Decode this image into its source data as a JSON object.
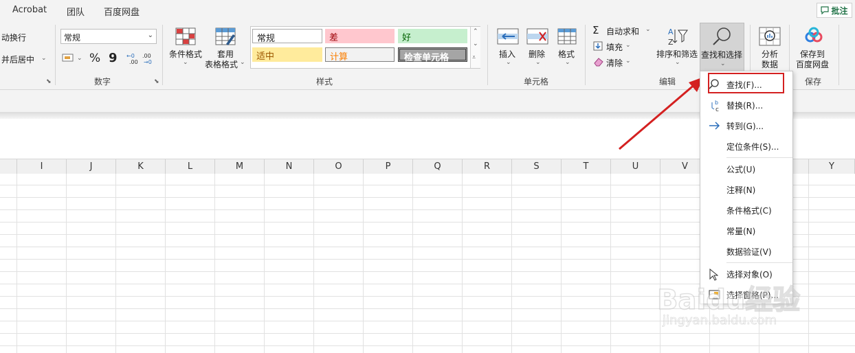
{
  "menubar": {
    "tabs": [
      "Acrobat",
      "团队",
      "百度网盘"
    ],
    "comment_label": "批注"
  },
  "ribbon": {
    "alignment": {
      "wrap_label": "动换行",
      "merge_label": "并后居中"
    },
    "number": {
      "format_value": "常规",
      "percent_symbol": "%",
      "comma_symbol": "9",
      "group_label": "数字"
    },
    "styles": {
      "conditional_format": "条件格式",
      "table_format_line1": "套用",
      "table_format_line2": "表格格式",
      "cells": [
        "常规",
        "差",
        "好",
        "适中",
        "计算",
        "检查单元格"
      ],
      "group_label": "样式"
    },
    "cells": {
      "insert": "插入",
      "delete": "删除",
      "format": "格式",
      "group_label": "单元格"
    },
    "editing": {
      "autosum": "自动求和",
      "fill": "填充",
      "clear": "清除",
      "sort_filter": "排序和筛选",
      "find_select": "查找和选择",
      "group_label": "编辑"
    },
    "analyze": {
      "line1": "分析",
      "line2": "数据"
    },
    "save": {
      "line1": "保存到",
      "line2": "百度网盘",
      "group_label": "保存"
    }
  },
  "columns": [
    "I",
    "J",
    "K",
    "L",
    "M",
    "N",
    "O",
    "P",
    "Q",
    "R",
    "S",
    "T",
    "U",
    "V",
    "Y"
  ],
  "find_menu": {
    "items": [
      {
        "label": "查找(F)...",
        "icon": "magnifier-icon"
      },
      {
        "label": "替换(R)...",
        "icon": "replace-icon"
      },
      {
        "label": "转到(G)...",
        "icon": "arrow-right-icon"
      },
      {
        "label": "定位条件(S)...",
        "icon": ""
      },
      {
        "label": "公式(U)",
        "icon": ""
      },
      {
        "label": "注释(N)",
        "icon": ""
      },
      {
        "label": "条件格式(C)",
        "icon": ""
      },
      {
        "label": "常量(N)",
        "icon": ""
      },
      {
        "label": "数据验证(V)",
        "icon": ""
      },
      {
        "label": "选择对象(O)",
        "icon": "pointer-icon"
      },
      {
        "label": "选择窗格(P)...",
        "icon": "selection-pane-icon"
      }
    ]
  },
  "watermark": {
    "brand": "Baidu经验",
    "url": "jingyan.baidu.com"
  },
  "colors": {
    "annotation_red": "#d42020",
    "accent_green": "#1e7145"
  }
}
